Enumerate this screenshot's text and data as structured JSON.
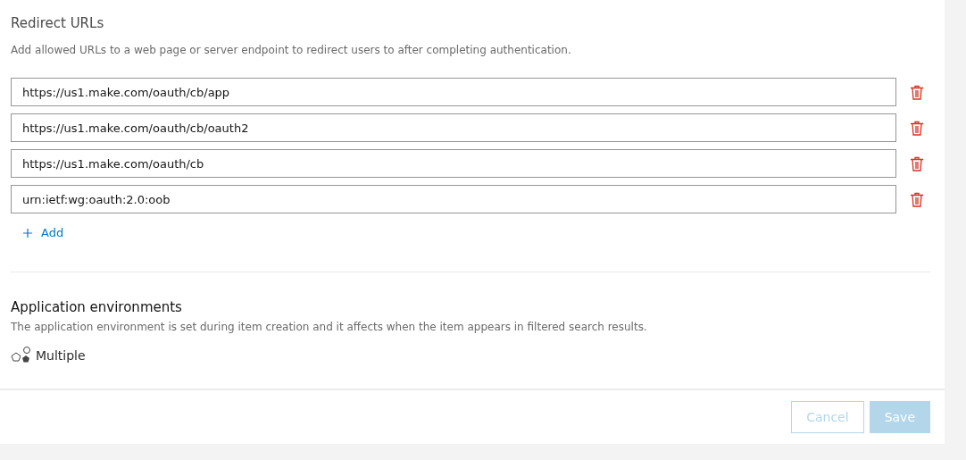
{
  "redirect": {
    "title": "Redirect URLs",
    "description": "Add allowed URLs to a web page or server endpoint to redirect users to after completing authentication.",
    "urls": [
      {
        "value": "https://us1.make.com/oauth/cb/app"
      },
      {
        "value": "https://us1.make.com/oauth/cb/oauth2"
      },
      {
        "value": "https://us1.make.com/oauth/cb"
      },
      {
        "value": "urn:ietf:wg:oauth:2.0:oob"
      }
    ],
    "add_label": "Add"
  },
  "environments": {
    "title": "Application environments",
    "description": "The application environment is set during item creation and it affects when the item appears in filtered search results.",
    "value": "Multiple"
  },
  "footer": {
    "buttons": [
      {
        "label": "Cancel",
        "kind": "secondary",
        "disabled": true
      },
      {
        "label": "Save",
        "kind": "primary",
        "disabled": true
      }
    ]
  }
}
